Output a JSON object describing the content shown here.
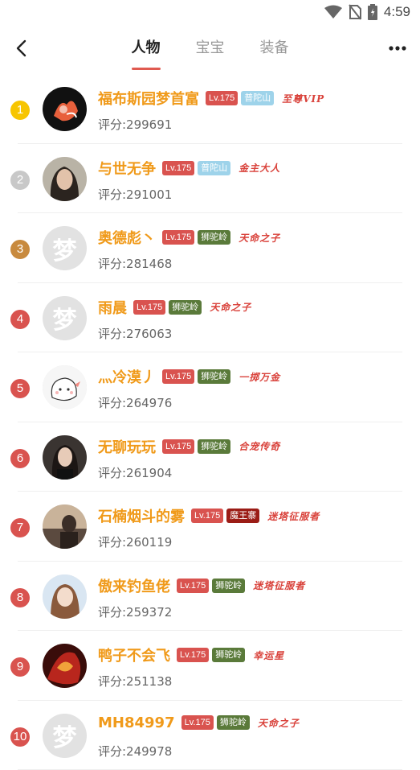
{
  "status_bar": {
    "time": "4:59"
  },
  "header": {
    "tabs": [
      {
        "label": "人物",
        "active": true
      },
      {
        "label": "宝宝",
        "active": false
      },
      {
        "label": "装备",
        "active": false
      }
    ]
  },
  "colors": {
    "accent": "#e05a50",
    "name": "#f09a1a",
    "level_badge": "#d9534f",
    "title_text": "#d9413a",
    "rank_1": "#f7c500",
    "rank_2": "#c8c8c8",
    "rank_3": "#c88a3e",
    "rank_other": "#d9534f",
    "sect_putuo": "#9ed3ea",
    "sect_shituo": "#5a7a3a",
    "sect_mowang": "#9b1c16"
  },
  "rankings": [
    {
      "rank": "1",
      "name": "福布斯园梦首富",
      "level": "Lv.175",
      "sect": "普陀山",
      "title": "至尊VIP",
      "score": "评分:299691",
      "avatar": "photo-fox"
    },
    {
      "rank": "2",
      "name": "与世无争",
      "level": "Lv.175",
      "sect": "普陀山",
      "title": "金主大人",
      "score": "评分:291001",
      "avatar": "photo-woman"
    },
    {
      "rank": "3",
      "name": "奥德彪丶",
      "level": "Lv.175",
      "sect": "狮驼岭",
      "title": "天命之子",
      "score": "评分:281468",
      "avatar": "placeholder",
      "placeholder_char": "梦"
    },
    {
      "rank": "4",
      "name": "雨晨",
      "level": "Lv.175",
      "sect": "狮驼岭",
      "title": "天命之子",
      "score": "评分:276063",
      "avatar": "placeholder",
      "placeholder_char": "梦"
    },
    {
      "rank": "5",
      "name": "灬冷漠丿",
      "level": "Lv.175",
      "sect": "狮驼岭",
      "title": "一掷万金",
      "score": "评分:264976",
      "avatar": "cartoon"
    },
    {
      "rank": "6",
      "name": "无聊玩玩",
      "level": "Lv.175",
      "sect": "狮驼岭",
      "title": "合宠传奇",
      "score": "评分:261904",
      "avatar": "photo-woman-dark"
    },
    {
      "rank": "7",
      "name": "石楠烟斗的雾",
      "level": "Lv.175",
      "sect": "魔王寨",
      "title": "迷塔征服者",
      "score": "评分:260119",
      "avatar": "photo-man"
    },
    {
      "rank": "8",
      "name": "傲来钓鱼佬",
      "level": "Lv.175",
      "sect": "狮驼岭",
      "title": "迷塔征服者",
      "score": "评分:259372",
      "avatar": "photo-woman-light"
    },
    {
      "rank": "9",
      "name": "鸭子不会飞",
      "level": "Lv.175",
      "sect": "狮驼岭",
      "title": "幸运星",
      "score": "评分:251138",
      "avatar": "photo-art"
    },
    {
      "rank": "10",
      "name": "MH84997",
      "level": "Lv.175",
      "sect": "狮驼岭",
      "title": "天命之子",
      "score": "评分:249978",
      "avatar": "placeholder",
      "placeholder_char": "梦"
    }
  ]
}
